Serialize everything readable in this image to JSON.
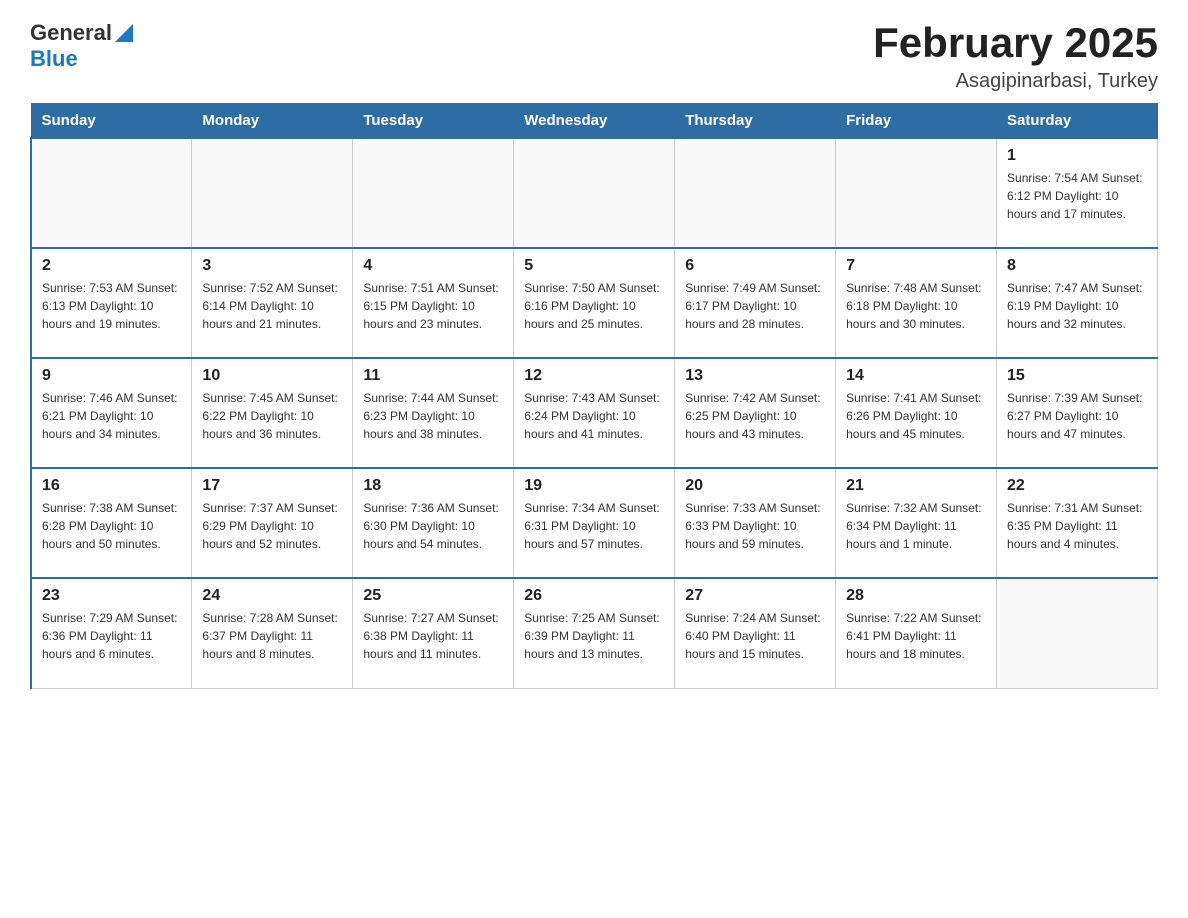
{
  "header": {
    "logo_general": "General",
    "logo_blue": "Blue",
    "month_title": "February 2025",
    "location": "Asagipinarbasi, Turkey"
  },
  "weekdays": [
    "Sunday",
    "Monday",
    "Tuesday",
    "Wednesday",
    "Thursday",
    "Friday",
    "Saturday"
  ],
  "weeks": [
    [
      {
        "day": "",
        "info": ""
      },
      {
        "day": "",
        "info": ""
      },
      {
        "day": "",
        "info": ""
      },
      {
        "day": "",
        "info": ""
      },
      {
        "day": "",
        "info": ""
      },
      {
        "day": "",
        "info": ""
      },
      {
        "day": "1",
        "info": "Sunrise: 7:54 AM\nSunset: 6:12 PM\nDaylight: 10 hours and 17 minutes."
      }
    ],
    [
      {
        "day": "2",
        "info": "Sunrise: 7:53 AM\nSunset: 6:13 PM\nDaylight: 10 hours and 19 minutes."
      },
      {
        "day": "3",
        "info": "Sunrise: 7:52 AM\nSunset: 6:14 PM\nDaylight: 10 hours and 21 minutes."
      },
      {
        "day": "4",
        "info": "Sunrise: 7:51 AM\nSunset: 6:15 PM\nDaylight: 10 hours and 23 minutes."
      },
      {
        "day": "5",
        "info": "Sunrise: 7:50 AM\nSunset: 6:16 PM\nDaylight: 10 hours and 25 minutes."
      },
      {
        "day": "6",
        "info": "Sunrise: 7:49 AM\nSunset: 6:17 PM\nDaylight: 10 hours and 28 minutes."
      },
      {
        "day": "7",
        "info": "Sunrise: 7:48 AM\nSunset: 6:18 PM\nDaylight: 10 hours and 30 minutes."
      },
      {
        "day": "8",
        "info": "Sunrise: 7:47 AM\nSunset: 6:19 PM\nDaylight: 10 hours and 32 minutes."
      }
    ],
    [
      {
        "day": "9",
        "info": "Sunrise: 7:46 AM\nSunset: 6:21 PM\nDaylight: 10 hours and 34 minutes."
      },
      {
        "day": "10",
        "info": "Sunrise: 7:45 AM\nSunset: 6:22 PM\nDaylight: 10 hours and 36 minutes."
      },
      {
        "day": "11",
        "info": "Sunrise: 7:44 AM\nSunset: 6:23 PM\nDaylight: 10 hours and 38 minutes."
      },
      {
        "day": "12",
        "info": "Sunrise: 7:43 AM\nSunset: 6:24 PM\nDaylight: 10 hours and 41 minutes."
      },
      {
        "day": "13",
        "info": "Sunrise: 7:42 AM\nSunset: 6:25 PM\nDaylight: 10 hours and 43 minutes."
      },
      {
        "day": "14",
        "info": "Sunrise: 7:41 AM\nSunset: 6:26 PM\nDaylight: 10 hours and 45 minutes."
      },
      {
        "day": "15",
        "info": "Sunrise: 7:39 AM\nSunset: 6:27 PM\nDaylight: 10 hours and 47 minutes."
      }
    ],
    [
      {
        "day": "16",
        "info": "Sunrise: 7:38 AM\nSunset: 6:28 PM\nDaylight: 10 hours and 50 minutes."
      },
      {
        "day": "17",
        "info": "Sunrise: 7:37 AM\nSunset: 6:29 PM\nDaylight: 10 hours and 52 minutes."
      },
      {
        "day": "18",
        "info": "Sunrise: 7:36 AM\nSunset: 6:30 PM\nDaylight: 10 hours and 54 minutes."
      },
      {
        "day": "19",
        "info": "Sunrise: 7:34 AM\nSunset: 6:31 PM\nDaylight: 10 hours and 57 minutes."
      },
      {
        "day": "20",
        "info": "Sunrise: 7:33 AM\nSunset: 6:33 PM\nDaylight: 10 hours and 59 minutes."
      },
      {
        "day": "21",
        "info": "Sunrise: 7:32 AM\nSunset: 6:34 PM\nDaylight: 11 hours and 1 minute."
      },
      {
        "day": "22",
        "info": "Sunrise: 7:31 AM\nSunset: 6:35 PM\nDaylight: 11 hours and 4 minutes."
      }
    ],
    [
      {
        "day": "23",
        "info": "Sunrise: 7:29 AM\nSunset: 6:36 PM\nDaylight: 11 hours and 6 minutes."
      },
      {
        "day": "24",
        "info": "Sunrise: 7:28 AM\nSunset: 6:37 PM\nDaylight: 11 hours and 8 minutes."
      },
      {
        "day": "25",
        "info": "Sunrise: 7:27 AM\nSunset: 6:38 PM\nDaylight: 11 hours and 11 minutes."
      },
      {
        "day": "26",
        "info": "Sunrise: 7:25 AM\nSunset: 6:39 PM\nDaylight: 11 hours and 13 minutes."
      },
      {
        "day": "27",
        "info": "Sunrise: 7:24 AM\nSunset: 6:40 PM\nDaylight: 11 hours and 15 minutes."
      },
      {
        "day": "28",
        "info": "Sunrise: 7:22 AM\nSunset: 6:41 PM\nDaylight: 11 hours and 18 minutes."
      },
      {
        "day": "",
        "info": ""
      }
    ]
  ]
}
